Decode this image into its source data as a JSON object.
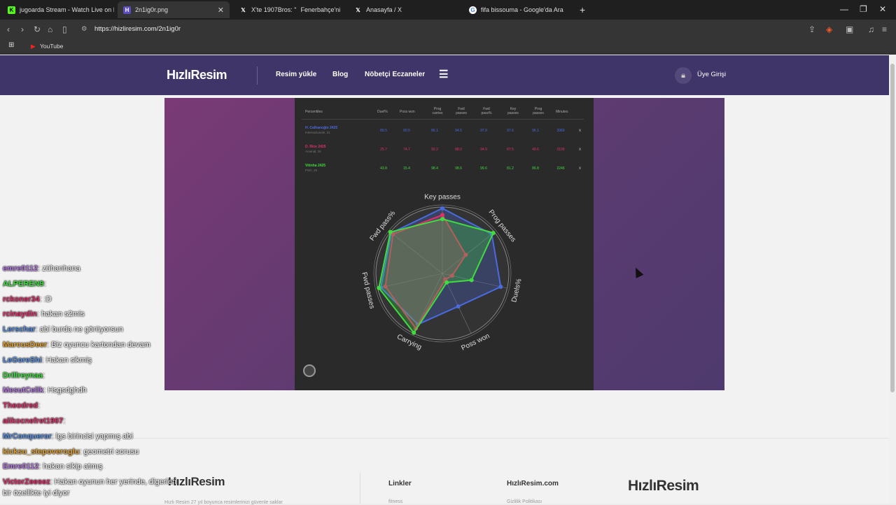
{
  "tabs": [
    {
      "title": "jugoarda Stream - Watch Live on Kick",
      "icon": "kick-icon",
      "fav": "K",
      "color": "#53fc18"
    },
    {
      "title": "2n1ig0r.png",
      "icon": "hizliresim-icon",
      "fav": "H",
      "color": "#5b4cc4"
    },
    {
      "title": "X'te 1907Bros: \"",
      "icon": "x-icon",
      "fav": "X",
      "color": "#000000"
    },
    {
      "title": "Fenerbahçe'ni",
      "icon": "x-icon",
      "fav": "",
      "color": ""
    },
    {
      "title": "Anasayfa / X",
      "icon": "x-icon",
      "fav": "X",
      "color": "#000000"
    },
    {
      "title": "fifa bissouma - Google'da Ara",
      "icon": "google-icon",
      "fav": "G",
      "color": "#ffffff"
    }
  ],
  "url": "https://hizliresim.com/2n1ig0r",
  "bookmark": "YouTube",
  "site": {
    "logo": "HızlıResim",
    "nav": [
      "Resim yükle",
      "Blog",
      "Nöbetçi Eczaneler"
    ],
    "login": "Üye Girişi"
  },
  "table": {
    "headers": [
      "Percentiles",
      "Duel%",
      "Poss won",
      "Prog carries",
      "Fwd passes",
      "Fwd pass%",
      "Key passes",
      "Prog passes",
      "Minutes"
    ],
    "rows": [
      {
        "name": "H. Calhanoğlu 2425",
        "sub": "Internazionale, 31",
        "color": "#4a6be0",
        "values": [
          "89.5",
          "60.5",
          "86.1",
          "94.5",
          "97.9",
          "97.6",
          "96.1",
          "2069"
        ],
        "x": "x"
      },
      {
        "name": "D. Rice 2425",
        "sub": "Arsenal, 26",
        "color": "#e0306a",
        "values": [
          "25.7",
          "74.7",
          "92.2",
          "88.0",
          "94.9",
          "87.5",
          "49.6",
          "3109"
        ],
        "x": "x"
      },
      {
        "name": "Vitinha 2425",
        "sub": "PSG, 25",
        "color": "#3fdc3f",
        "values": [
          "43.8",
          "15.4",
          "98.4",
          "98.6",
          "99.6",
          "81.2",
          "86.8",
          "2246"
        ],
        "x": "x"
      }
    ]
  },
  "chart_data": {
    "type": "radar",
    "axes": [
      "Key passes",
      "Prog passes",
      "Duels%",
      "Poss won",
      "Carrying",
      "Fwd passes",
      "Fwd pass%"
    ],
    "series": [
      {
        "name": "H. Calhanoğlu 2425",
        "color": "#4a6be0",
        "values": [
          0.98,
          0.95,
          0.9,
          0.55,
          0.85,
          0.95,
          0.98
        ]
      },
      {
        "name": "D. Rice 2425",
        "color": "#e0306a",
        "values": [
          0.88,
          0.45,
          0.15,
          0.1,
          0.92,
          0.88,
          0.95
        ]
      },
      {
        "name": "Vitinha 2425",
        "color": "#3fdc3f",
        "values": [
          0.82,
          0.98,
          0.45,
          0.15,
          0.99,
          0.98,
          1.0
        ]
      }
    ]
  },
  "chat": [
    {
      "user": "emre0112",
      "msg": ": zühanhana",
      "color": "#b57be0"
    },
    {
      "user": "ALPEREN9",
      "msg": ":",
      "color": "#3fdc3f"
    },
    {
      "user": "rckoner34",
      "msg": ": :D",
      "color": "#e0306a"
    },
    {
      "user": "rcinaydin",
      "msg": ": hakan s2mis",
      "color": "#e0306a"
    },
    {
      "user": "Lerschar",
      "msg": ": abi burda ne görüyorsun",
      "color": "#5a8fe0"
    },
    {
      "user": "MarcusDeer",
      "msg": ": Biz oyuncu kartondan devam",
      "color": "#e0a030"
    },
    {
      "user": "LeGoreShi",
      "msg": ": Hakan sikmiş",
      "color": "#5a8fe0"
    },
    {
      "user": "Drillreynaa",
      "msg": ":",
      "color": "#3fdc3f"
    },
    {
      "user": "MesutCelik",
      "msg": ": Hsgsdghdh",
      "color": "#b57be0"
    },
    {
      "user": "Theodred",
      "msg": ":",
      "color": "#e0306a"
    },
    {
      "user": "alikocnefret1907",
      "msg": ":",
      "color": "#e0306a"
    },
    {
      "user": "MrConqueror",
      "msg": ": lgs birincisi yapmış abi",
      "color": "#5a8fe0"
    },
    {
      "user": "kicksu_stepoveroglu",
      "msg": ": geometri sorusu",
      "color": "#e0a030"
    },
    {
      "user": "Emre0112",
      "msg": ": hakan sikip atmış",
      "color": "#b57be0"
    },
    {
      "user": "VictorZeesez",
      "msg": ": Hakan oyunun her yerinde, digerleri",
      "color": "#e0306a"
    },
    {
      "user": "",
      "msg": "bir özellikte iyi diyor",
      "color": "#ffffff"
    }
  ],
  "footer": {
    "logo": "HızlıResim",
    "col1": "Linkler",
    "col2": "HızlıResim.com",
    "text": "Hızlı Resim 27 yıl boyunca resimlerinizi güvenle saklar",
    "link1": "fitness",
    "link2": "Gizlilik Politikası"
  }
}
